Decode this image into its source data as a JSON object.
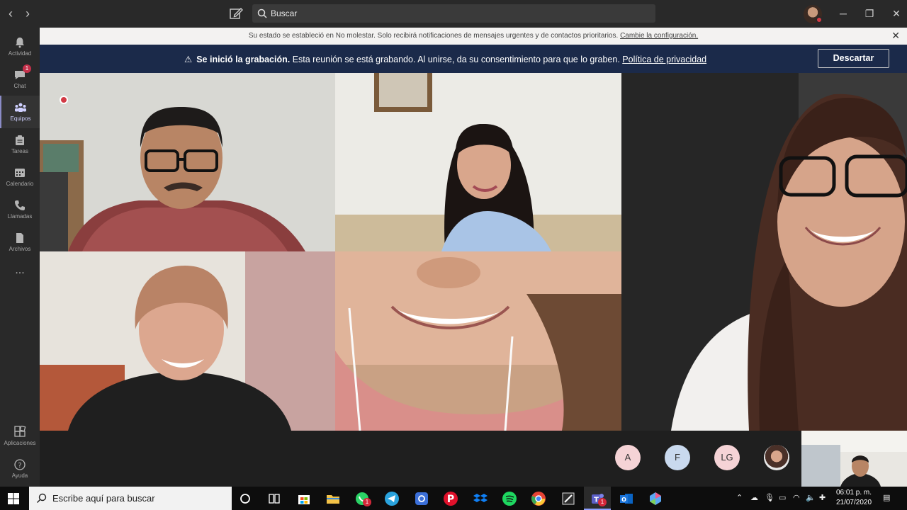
{
  "titlebar": {
    "search_placeholder": "Buscar"
  },
  "rail": {
    "items": [
      {
        "label": "Actividad"
      },
      {
        "label": "Chat",
        "badge": "1"
      },
      {
        "label": "Equipos"
      },
      {
        "label": "Tareas"
      },
      {
        "label": "Calendario"
      },
      {
        "label": "Llamadas"
      },
      {
        "label": "Archivos"
      },
      {
        "label": "..."
      },
      {
        "label": "Aplicaciones"
      },
      {
        "label": "Ayuda"
      }
    ]
  },
  "notice": {
    "text": "Su estado se estableció en No molestar. Solo recibirá notificaciones de mensajes urgentes y de contactos prioritarios.",
    "link": "Cambie la configuración."
  },
  "recording": {
    "title": "Se inició la grabación.",
    "text": "Esta reunión se está grabando. Al unirse, da su consentimiento para que lo graben.",
    "link": "Política de privacidad",
    "dismiss": "Descartar"
  },
  "roster": [
    {
      "initials": "A"
    },
    {
      "initials": "F"
    },
    {
      "initials": "LG"
    }
  ],
  "taskbar": {
    "search_placeholder": "Escribe aquí para buscar",
    "time": "06:01 p. m.",
    "date": "21/07/2020",
    "whatsapp_badge": "1",
    "teams_badge": "1"
  }
}
